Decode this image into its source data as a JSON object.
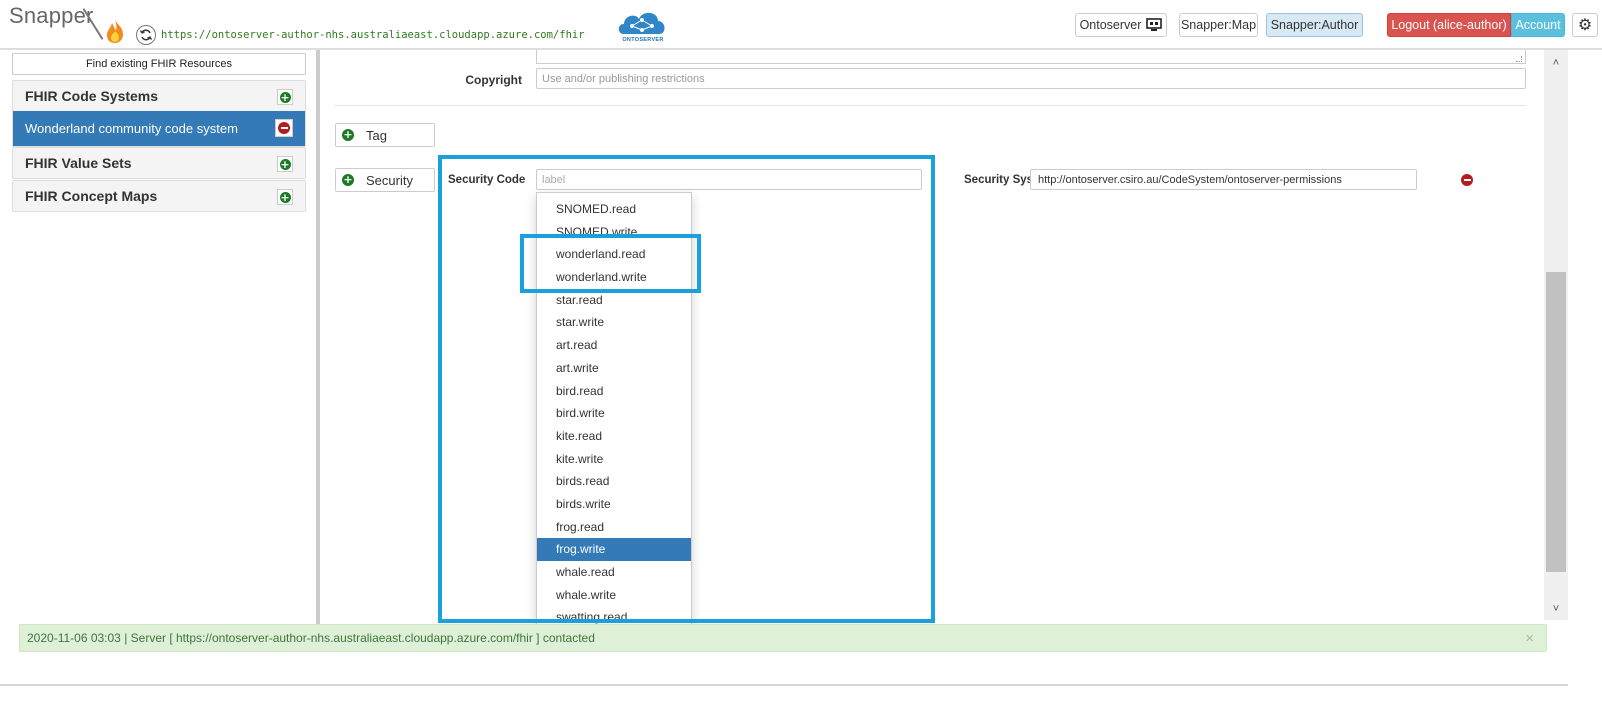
{
  "header": {
    "brand": "Snapper",
    "server_url": "https://ontoserver-author-nhs.australiaeast.cloudapp.azure.com/fhir",
    "logo_text": "ONTOSERVER",
    "buttons": {
      "ontoserver": "Ontoserver",
      "snapper_map": "Snapper:Map",
      "snapper_author": "Snapper:Author",
      "logout": "Logout (alice-author)",
      "account": "Account"
    },
    "icons": {
      "refresh": "refresh-icon",
      "monitor": "monitor-icon",
      "gear": "gear-icon",
      "flame": "flame-icon"
    }
  },
  "sidebar": {
    "find_button": "Find existing FHIR Resources",
    "groups": [
      {
        "label": "FHIR Code Systems",
        "items": [
          "Wonderland community code system"
        ]
      },
      {
        "label": "FHIR Value Sets"
      },
      {
        "label": "FHIR Concept Maps"
      }
    ]
  },
  "main": {
    "copyright": {
      "label": "Copyright",
      "placeholder": "Use and/or publishing restrictions"
    },
    "tag_button": "Tag",
    "security_button": "Security",
    "security_code": {
      "label": "Security Code",
      "placeholder": "label"
    },
    "security_system": {
      "label": "Security System",
      "value": "http://ontoserver.csiro.au/CodeSystem/ontoserver-permissions"
    },
    "dropdown": {
      "selected": "frog.write",
      "options": [
        "SNOMED.read",
        "SNOMED.write",
        "wonderland.read",
        "wonderland.write",
        "star.read",
        "star.write",
        "art.read",
        "art.write",
        "bird.read",
        "bird.write",
        "kite.read",
        "kite.write",
        "birds.read",
        "birds.write",
        "frog.read",
        "frog.write",
        "whale.read",
        "whale.write",
        "swatting.read"
      ]
    }
  },
  "status": {
    "message": "2020-11-06 03:03 | Server [ https://ontoserver-author-nhs.australiaeast.cloudapp.azure.com/fhir ] contacted",
    "close": "×"
  },
  "colors": {
    "primary": "#337ab7",
    "danger": "#d9534f",
    "info": "#5bc0de",
    "success_bg": "#dff0d8",
    "success_text": "#3c763d",
    "highlight": "#1aa0db",
    "add_green": "#1d7a24",
    "remove_red": "#b31d1d"
  }
}
